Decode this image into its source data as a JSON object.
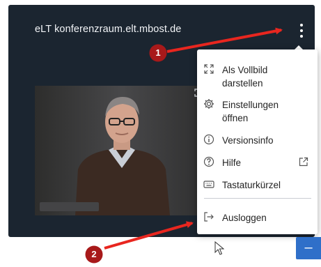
{
  "header": {
    "room_title": "eLT konferenzraum.elt.mbost.de"
  },
  "menu": {
    "items": [
      {
        "icon": "fullscreen-icon",
        "label_line1": "Als Vollbild",
        "label_line2": "darstellen"
      },
      {
        "icon": "gear-icon",
        "label_line1": "Einstellungen",
        "label_line2": "öffnen"
      },
      {
        "icon": "info-icon",
        "label": "Versionsinfo"
      },
      {
        "icon": "help-icon",
        "label": "Hilfe"
      },
      {
        "icon": "keyboard-icon",
        "label": "Tastaturkürzel"
      },
      {
        "icon": "logout-icon",
        "label": "Ausloggen"
      }
    ]
  },
  "annotations": {
    "callout_1": "1",
    "callout_2": "2",
    "arrow_color": "#e8261f",
    "callout_color": "#a8191a"
  },
  "colors": {
    "window_background": "#1b2530",
    "accent_button": "#2f6fc9"
  },
  "corner_button": {
    "symbol": "–"
  }
}
